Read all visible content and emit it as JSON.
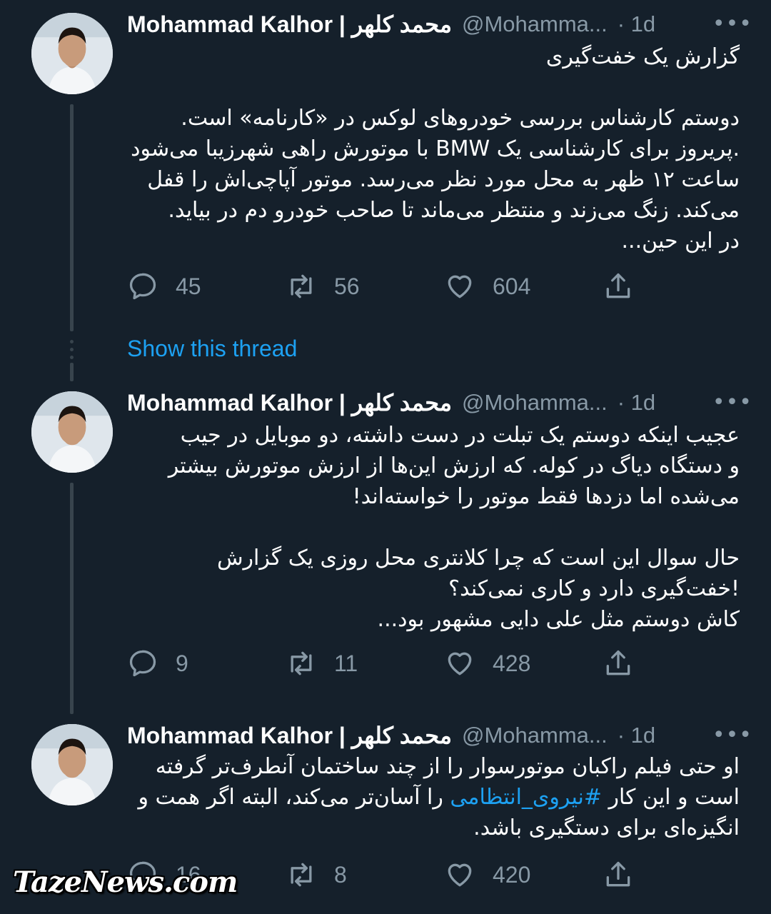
{
  "tweets": [
    {
      "name": "Mohammad Kalhor | محمد کلهر",
      "handle": "@Mohamma...",
      "time": "· 1d",
      "text": "گزارش یک خفت‌گیری\n\nدوستم کارشناس بررسی خودروهای لوکس در «کارنامه» است.\n.پریروز برای کارشناسی یک BMW با موتورش راهی شهرزیبا می‌شود\nساعت ۱۲ ظهر به محل مورد نظر می‌رسد. موتور آپاچی‌اش را قفل\nمی‌کند. زنگ می‌زند و منتظر می‌ماند تا صاحب خودرو دم در بیاید.\nدر این حین...",
      "replies": "45",
      "retweets": "56",
      "likes": "604"
    },
    {
      "name": "Mohammad Kalhor | محمد کلهر",
      "handle": "@Mohamma...",
      "time": "· 1d",
      "text": "عجیب اینکه دوستم یک تبلت در دست داشته، دو موبایل در جیب\nو دستگاه دیاگ در کوله. که ارزش این‌ها از ارزش موتورش بیشتر\nمی‌شده اما دزدها فقط موتور را خواسته‌اند!\n\nحال سوال این است که چرا کلانتری محل روزی یک گزارش\n!خفت‌گیری دارد و کاری نمی‌کند؟\nکاش دوستم مثل علی دایی مشهور بود...",
      "replies": "9",
      "retweets": "11",
      "likes": "428"
    },
    {
      "name": "Mohammad Kalhor | محمد کلهر",
      "handle": "@Mohamma...",
      "time": "· 1d",
      "text_before": "او حتی فیلم راکبان موتورسوار را از چند ساختمان آنطرف‌تر گرفته\nاست و این کار ",
      "hashtag": "#نیروی_انتظامی",
      "text_after": " را آسان‌تر می‌کند، البته اگر همت و\nانگیزه‌ای برای دستگیری باشد.",
      "replies": "16",
      "retweets": "8",
      "likes": "420"
    }
  ],
  "show_thread": "Show this thread",
  "more_icon": "•••",
  "watermark": "TazeNews.com",
  "colors": {
    "background": "#15202b",
    "secondary": "#8899a6",
    "link": "#1da1f2"
  }
}
